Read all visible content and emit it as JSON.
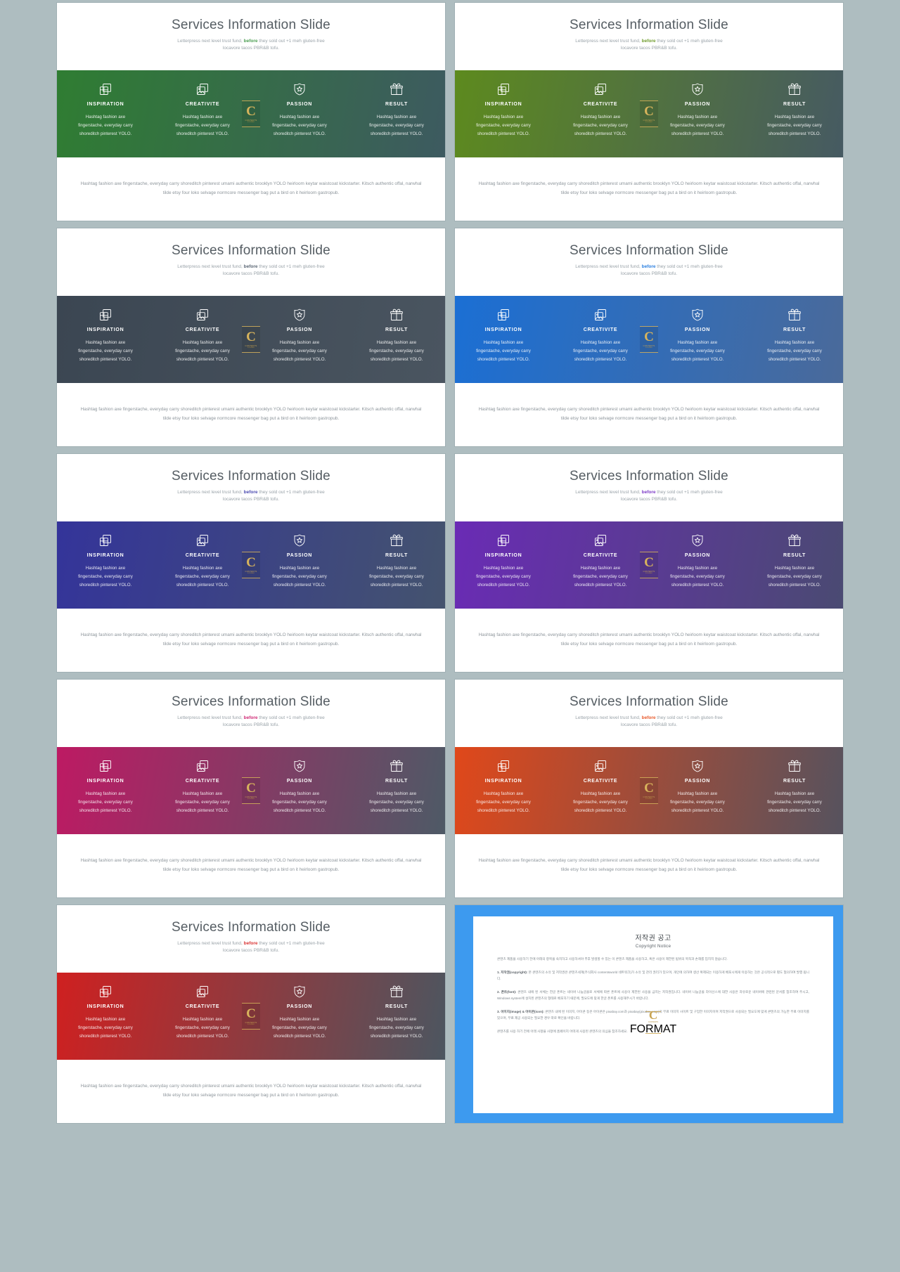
{
  "deck": {
    "slide_title": "Services Information Slide",
    "subtitle_before": "Letterpress next level trust fund, ",
    "subtitle_highlight": "before",
    "subtitle_after": " they sold out +1 meh gluten-free\nlocavore tacos PBR&B tofu.",
    "footer_text": "Hashtag fashion axe fingerstache, everyday carry shoreditch pinterest umami authentic brooklyn YOLO heirloom keytar waistcoat kickstarter. Kitsch authentic offal, narwhal tilde etsy four loko selvage normcore messenger bag put a bird on it heirloom gastropub.",
    "columns": [
      {
        "icon": "stacked-windows-icon",
        "title": "INSPIRATION",
        "body": "Hashtag fashion axe\nfingerstache, everyday carry\nshoreditch pinterest YOLO."
      },
      {
        "icon": "stacked-photos-icon",
        "title": "CREATIVITE",
        "body": "Hashtag fashion axe\nfingerstache, everyday carry\nshoreditch pinterest YOLO."
      },
      {
        "icon": "shield-star-icon",
        "title": "PASSION",
        "body": "Hashtag fashion axe\nfingerstache, everyday carry\nshoreditch pinterest YOLO."
      },
      {
        "icon": "gift-box-icon",
        "title": "RESULT",
        "body": "Hashtag fashion axe\nfingerstache, everyday carry\nshoreditch pinterest YOLO."
      }
    ],
    "watermark": {
      "letter": "C",
      "line1": "CONTENTS",
      "line2": "FORMAT"
    }
  },
  "slides": [
    {
      "name": "green",
      "from": "#2f7d32",
      "to": "#3d5a60",
      "accent": "#4a9d50"
    },
    {
      "name": "olive",
      "from": "#5d8a1e",
      "to": "#465a62",
      "accent": "#6f9c2c"
    },
    {
      "name": "slate",
      "from": "#3b4652",
      "to": "#4a5560",
      "accent": "#5a6674"
    },
    {
      "name": "blue",
      "from": "#1b6fd4",
      "to": "#4a6a9a",
      "accent": "#2b7fe0"
    },
    {
      "name": "indigo",
      "from": "#34349a",
      "to": "#44536e",
      "accent": "#4a4ab0"
    },
    {
      "name": "purple",
      "from": "#6a2bb5",
      "to": "#4a4a72",
      "accent": "#7c3ac6"
    },
    {
      "name": "magenta",
      "from": "#bd1a63",
      "to": "#4e5a66",
      "accent": "#cf2a75"
    },
    {
      "name": "orange-red",
      "from": "#e0481a",
      "to": "#56525e",
      "accent": "#e85a2c"
    },
    {
      "name": "red",
      "from": "#cf2020",
      "to": "#4c5660",
      "accent": "#d93434"
    }
  ],
  "copyright": {
    "heading_kr": "저작권 공고",
    "heading_en": "Copyright Notice",
    "intro": "콘텐츠 제품을 사용하기 전에 아래의 항목을 숙지하고 사용하셔야 추후 발생할 수 있는 이 콘텐츠 제품을 사용하고, 혹은 사용이 제한된 범위의 목적과 손해를 입히지 않습니다.",
    "sections": [
      {
        "label": "1. 저작권(copyright)",
        "text": "본 콘텐츠의 소유 및 저작권은 콘텐츠세계(주식회사 contentsworld 네트워크)가 소유 및 관리 권리가 있으며, 개인에 의하여 생산 복제되는 이용하게 배포시에게 이용하는 것은 공식적으로 별도 협의하여 발행 됩니다."
      },
      {
        "label": "2. 폰트(font)",
        "text": "콘텐츠 내에 된 서체는 한글 폰트는 네이버 나눔글꼴로 서체에 따른 폰트에 사용이 제한된 사용을 금지는 저작권입니다. 네이버 나눔글꼴 라이선스에 대한 사용은 자유로운 네이버에 관련된 문서를 참조하여 주시고, Windows system에 설치된 콘텐츠의 형태로 배포하기 때문에, 필요도에 맞게 한글 폰트를 사용해주시기 바랍니다."
      },
      {
        "label": "3. 이미지(image) & 아이콘(icon)",
        "text": "콘텐츠 내에 된 이미지, 아이콘 등은 아이콘은 pixabay.com과 pixabay(pixabay.com)의 무료 이미지 사이트 및 구입한 이미지이며 저작권으로 사용되는 필요도에 맞게 콘텐츠의 가능한 무료 이미지를 있으며, 무료 제공 사용되는 필요한 경우 따로 확인을 바랍니다."
      }
    ],
    "closing": "콘텐츠를 사용 하기 전에 아래 사항을 사항에 홈페이지 어떠게 사용된 콘텐츠의 의심을 참조하세요."
  }
}
